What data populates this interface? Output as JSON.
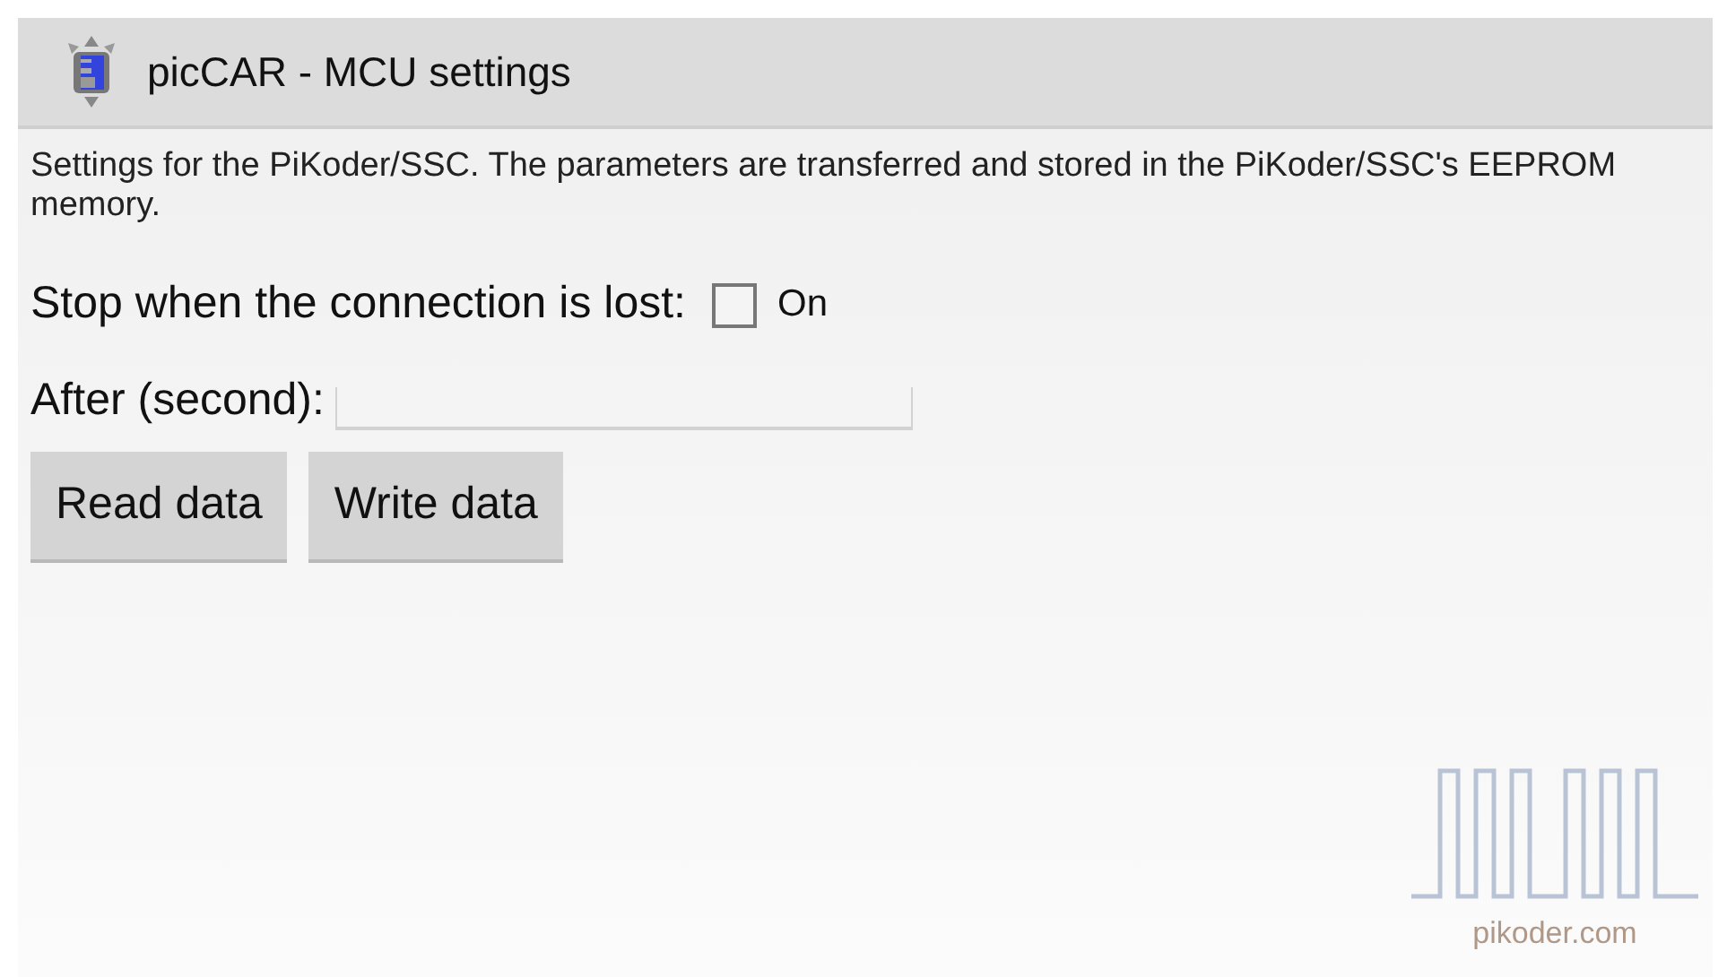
{
  "window": {
    "title": "picCAR - MCU settings"
  },
  "description": "Settings for the PiKoder/SSC. The parameters are transferred and stored in the PiKoder/SSC's EEPROM memory.",
  "stop_on_connection_lost": {
    "label": "Stop when the connection is lost:",
    "checkbox_label": "On",
    "checked": false
  },
  "after": {
    "label": "After (second):"
  },
  "buttons": [
    "Read data",
    "Write data"
  ],
  "logo": {
    "text": "pikoder.com"
  }
}
